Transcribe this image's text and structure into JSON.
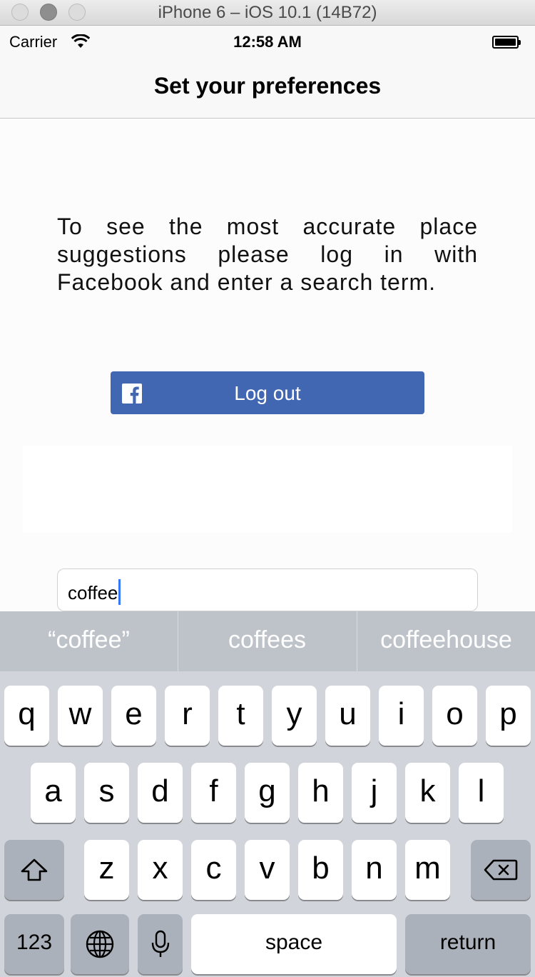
{
  "window": {
    "title": "iPhone 6 – iOS 10.1 (14B72)"
  },
  "status_bar": {
    "carrier": "Carrier",
    "time": "12:58 AM"
  },
  "nav": {
    "title": "Set your preferences"
  },
  "content": {
    "info_text": "To see the most accurate place suggestions please log in with Facebook and enter a search term.",
    "facebook_button_label": "Log out",
    "search_value": "coffee"
  },
  "keyboard": {
    "suggestions": [
      "“coffee”",
      "coffees",
      "coffeehouse"
    ],
    "row1": [
      "q",
      "w",
      "e",
      "r",
      "t",
      "y",
      "u",
      "i",
      "o",
      "p"
    ],
    "row2": [
      "a",
      "s",
      "d",
      "f",
      "g",
      "h",
      "j",
      "k",
      "l"
    ],
    "row3": [
      "z",
      "x",
      "c",
      "v",
      "b",
      "n",
      "m"
    ],
    "numbers_label": "123",
    "space_label": "space",
    "return_label": "return"
  },
  "colors": {
    "facebook_blue": "#4267b2",
    "caret_blue": "#3478f6",
    "keyboard_bg": "#d1d5db",
    "suggestion_bar_bg": "#bec3ca"
  }
}
